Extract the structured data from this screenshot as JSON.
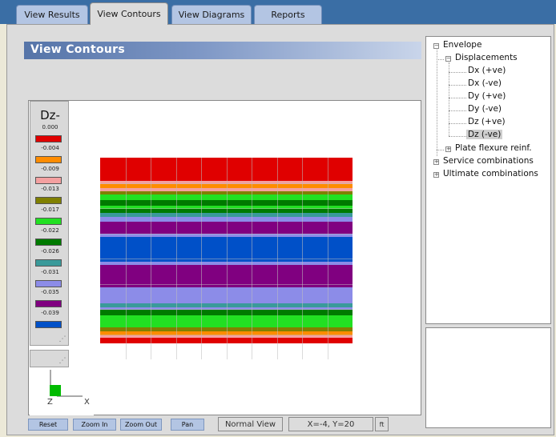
{
  "tabs": [
    {
      "label": "View Results",
      "active": false
    },
    {
      "label": "View Contours",
      "active": true
    },
    {
      "label": "View Diagrams",
      "active": false
    },
    {
      "label": "Reports",
      "active": false
    }
  ],
  "panel_title": "View Contours",
  "legend": {
    "title": "Dz-",
    "entries": [
      {
        "value": "0.000",
        "color": "#e00000"
      },
      {
        "value": "-0.004",
        "color": "#ff8c00"
      },
      {
        "value": "-0.009",
        "color": "#f4a0a0"
      },
      {
        "value": "-0.013",
        "color": "#808000"
      },
      {
        "value": "-0.017",
        "color": "#22e022"
      },
      {
        "value": "-0.022",
        "color": "#007a00"
      },
      {
        "value": "-0.026",
        "color": "#3a9a9a"
      },
      {
        "value": "-0.031",
        "color": "#8c8ce8"
      },
      {
        "value": "-0.035",
        "color": "#800080"
      },
      {
        "value": "-0.039",
        "color": "#0050c8"
      }
    ]
  },
  "axes": {
    "z_label": "Z",
    "x_label": "X",
    "axis_color": "#00bb00"
  },
  "contour_bands": [
    {
      "color": "#e00000",
      "h": 29
    },
    {
      "color": "#f4a0a0",
      "h": 4
    },
    {
      "color": "#ff8c00",
      "h": 5
    },
    {
      "color": "#f4a0a0",
      "h": 4
    },
    {
      "color": "#808000",
      "h": 4
    },
    {
      "color": "#22e022",
      "h": 7
    },
    {
      "color": "#007a00",
      "h": 7
    },
    {
      "color": "#22e022",
      "h": 4
    },
    {
      "color": "#007a00",
      "h": 5
    },
    {
      "color": "#3a9a9a",
      "h": 5
    },
    {
      "color": "#8c8ce8",
      "h": 6
    },
    {
      "color": "#800080",
      "h": 15
    },
    {
      "color": "#8c8ce8",
      "h": 4
    },
    {
      "color": "#0050c8",
      "h": 31
    },
    {
      "color": "#8c8ce8",
      "h": 4
    },
    {
      "color": "#800080",
      "h": 28
    },
    {
      "color": "#8c8ce8",
      "h": 20
    },
    {
      "color": "#3a9a9a",
      "h": 5
    },
    {
      "color": "#8c8ce8",
      "h": 3
    },
    {
      "color": "#007a00",
      "h": 7
    },
    {
      "color": "#22e022",
      "h": 15
    },
    {
      "color": "#808000",
      "h": 5
    },
    {
      "color": "#ff8c00",
      "h": 5
    },
    {
      "color": "#f4a0a0",
      "h": 3
    },
    {
      "color": "#e00000",
      "h": 7
    }
  ],
  "grid": {
    "columns": 10,
    "rows": 8
  },
  "toolbar": {
    "reset": "Reset",
    "zoom_in": "Zoom In",
    "zoom_out": "Zoom Out",
    "pan": "Pan",
    "view_mode": "Normal View",
    "coordinates": "X=-4, Y=20",
    "units": "ft"
  },
  "tree": {
    "envelope": "Envelope",
    "displacements": "Displacements",
    "dx_pos": "Dx (+ve)",
    "dx_neg": "Dx (-ve)",
    "dy_pos": "Dy (+ve)",
    "dy_neg": "Dy (-ve)",
    "dz_pos": "Dz (+ve)",
    "dz_neg": "Dz (-ve)",
    "plate_flexure": "Plate flexure reinf.",
    "service": "Service combinations",
    "ultimate": "Ultimate combinations"
  }
}
